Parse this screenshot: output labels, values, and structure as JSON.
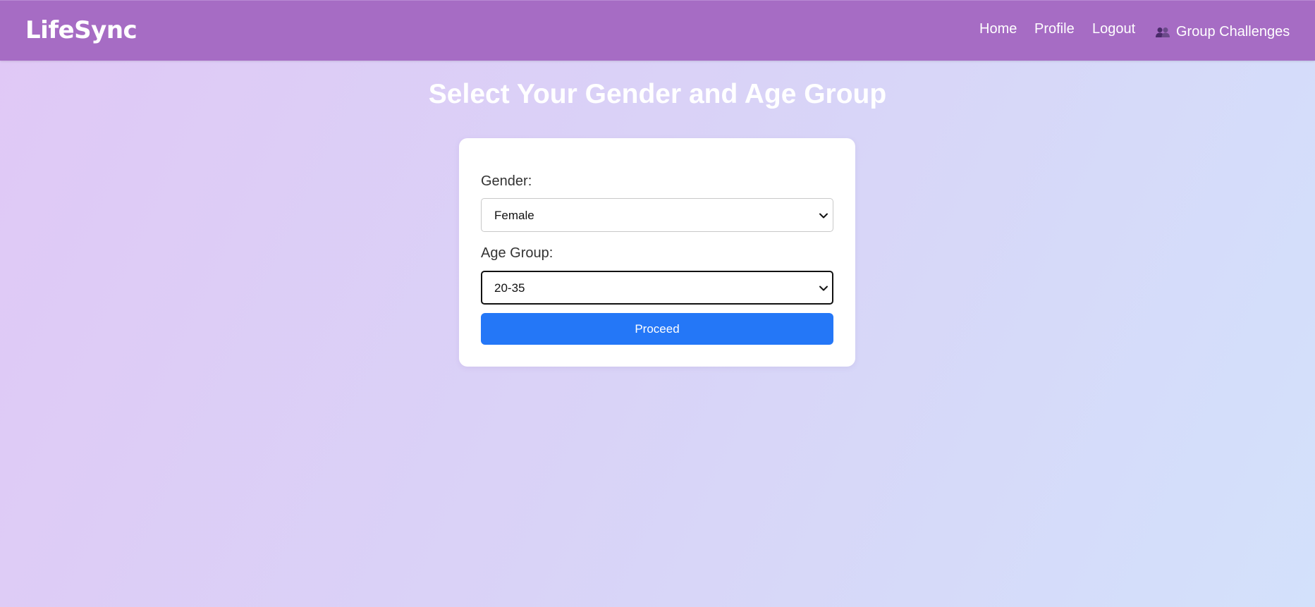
{
  "nav": {
    "brand": "LifeSync",
    "home": "Home",
    "profile": "Profile",
    "logout": "Logout",
    "group_challenges": "Group Challenges",
    "group_icon": "people-icon"
  },
  "main": {
    "title": "Select Your Gender and Age Group",
    "gender_label": "Gender:",
    "gender_value": "Female",
    "age_label": "Age Group:",
    "age_value": "20-35",
    "proceed_label": "Proceed"
  },
  "colors": {
    "navbar": "#a66cc4",
    "button": "#2477f7",
    "background_start": "#e0c8f6",
    "background_end": "#d3e1fb"
  }
}
